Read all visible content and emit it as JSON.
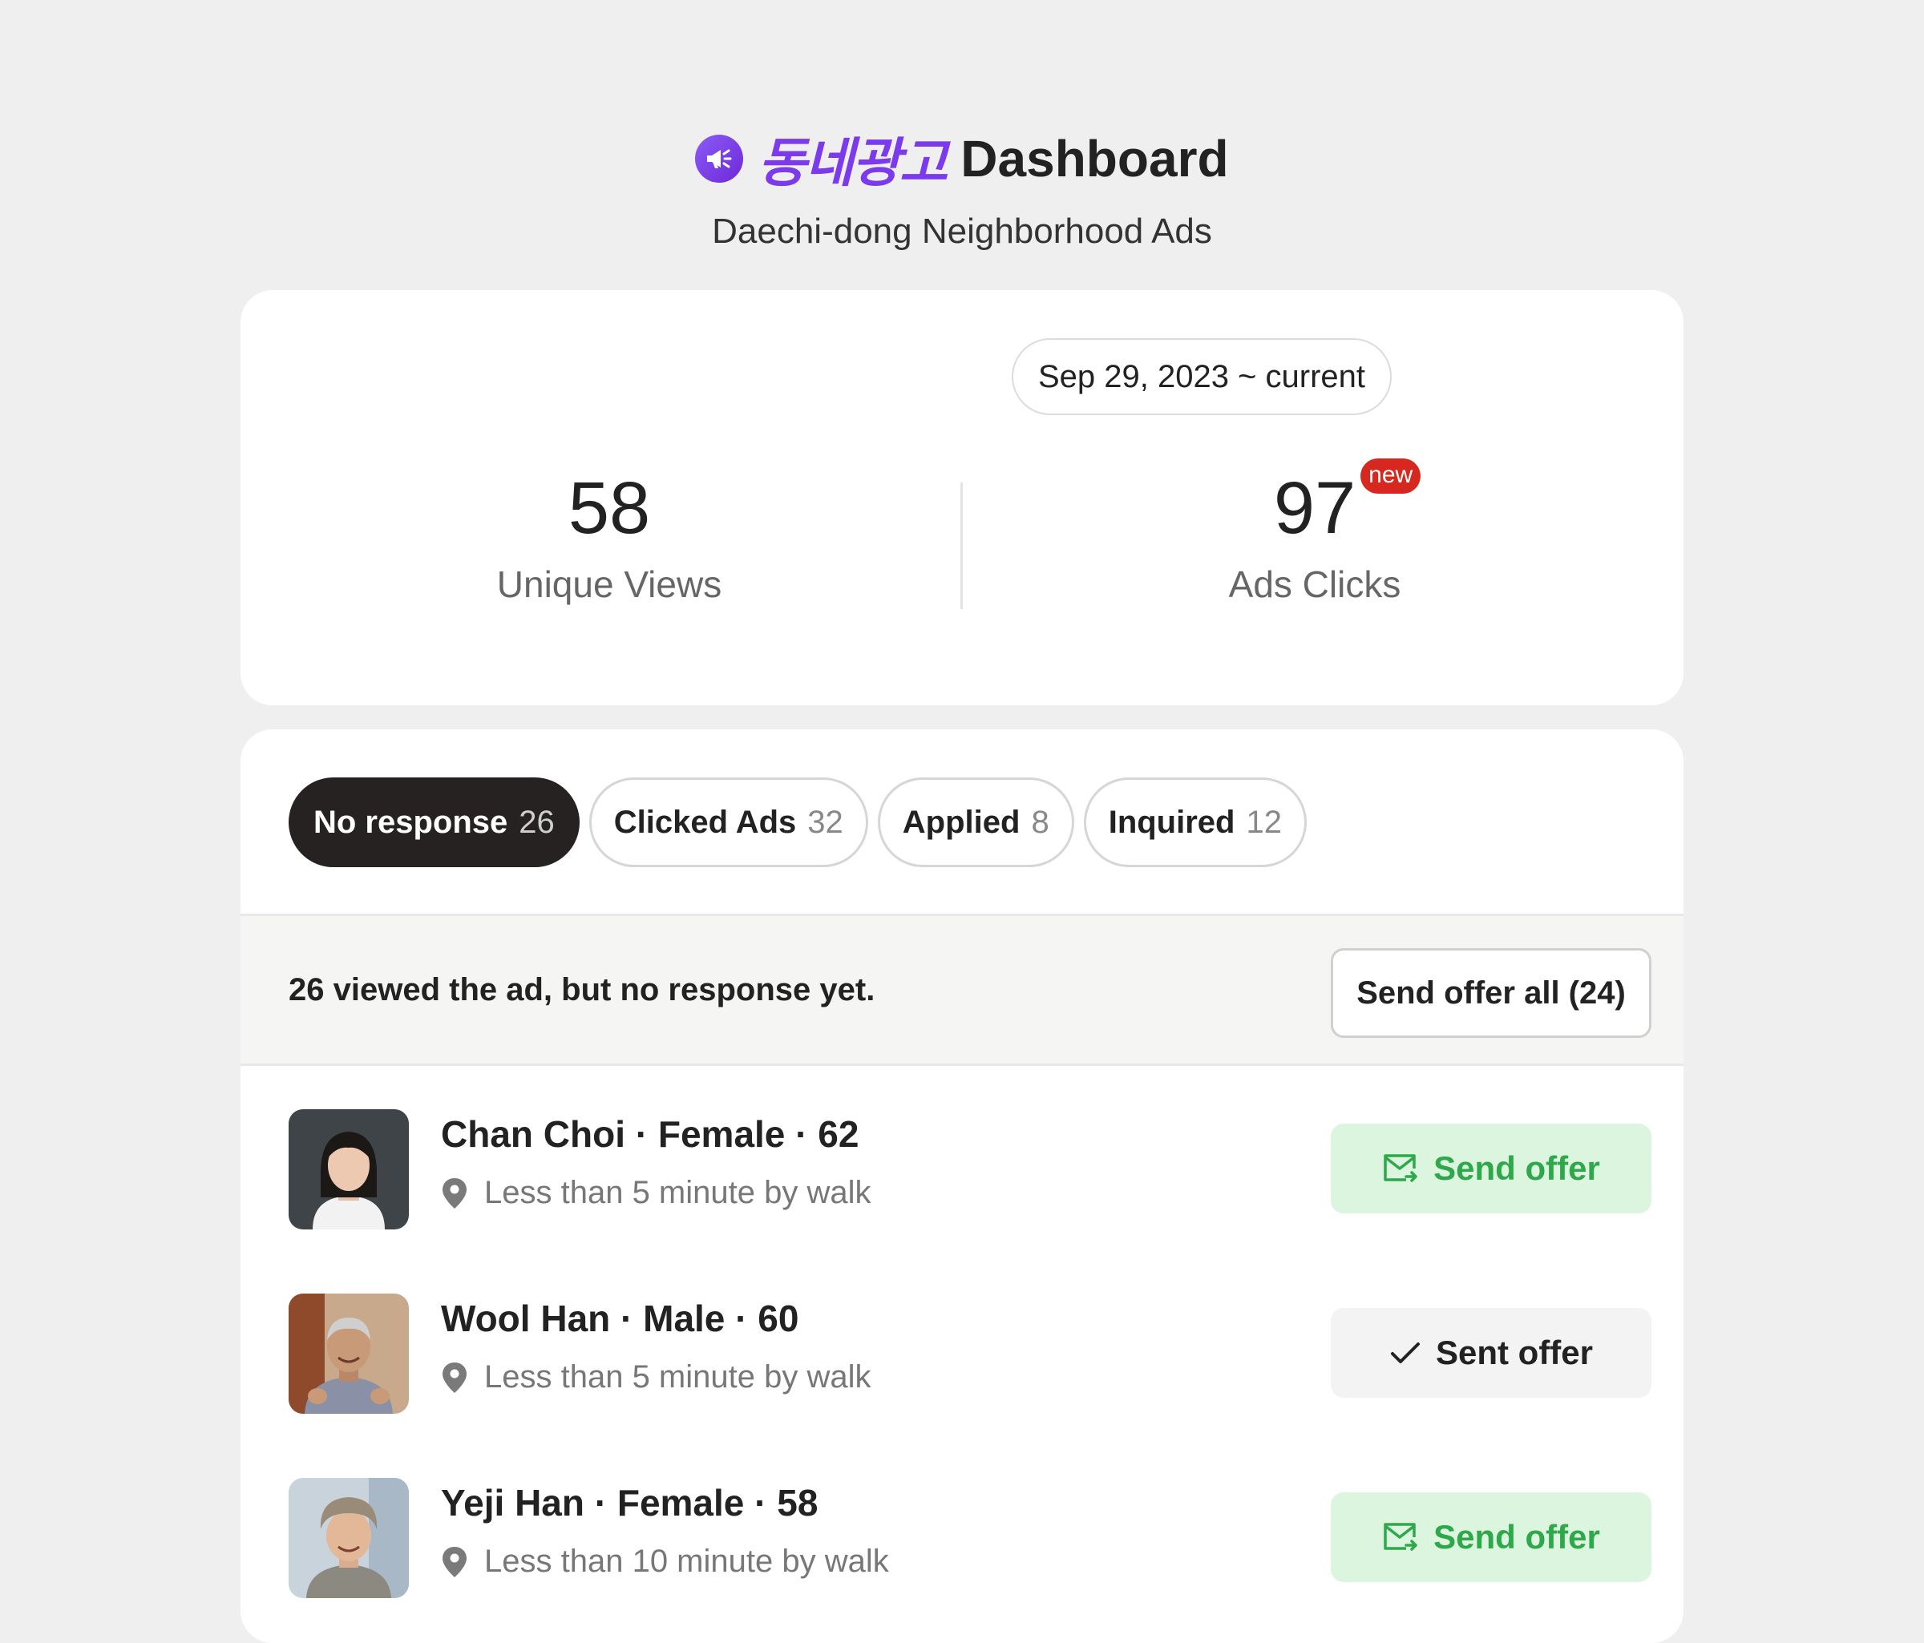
{
  "header": {
    "brand": "동네광고",
    "title": "Dashboard",
    "subtitle": "Daechi-dong Neighborhood Ads",
    "logo_icon": "megaphone-icon",
    "brand_color": "#7c3aed"
  },
  "stats": {
    "date_range": "Sep 29, 2023 ~ current",
    "unique_views": {
      "value": "58",
      "label": "Unique Views"
    },
    "ads_clicks": {
      "value": "97",
      "label": "Ads Clicks",
      "badge": "new"
    }
  },
  "tabs": [
    {
      "label": "No response",
      "count": "26",
      "active": true
    },
    {
      "label": "Clicked Ads",
      "count": "32",
      "active": false
    },
    {
      "label": "Applied",
      "count": "8",
      "active": false
    },
    {
      "label": "Inquired",
      "count": "12",
      "active": false
    }
  ],
  "info_bar": {
    "message": "26 viewed the ad, but no response yet.",
    "send_all_label": "Send offer all (24)"
  },
  "people": [
    {
      "name": "Chan Choi · Female · 62",
      "distance": "Less than 5 minute by walk",
      "action": "Send offer",
      "state": "send"
    },
    {
      "name": "Wool Han · Male · 60",
      "distance": "Less than 5 minute by walk",
      "action": "Sent offer",
      "state": "sent"
    },
    {
      "name": "Yeji Han · Female · 58",
      "distance": "Less than 10 minute by walk",
      "action": "Send offer",
      "state": "send"
    }
  ],
  "colors": {
    "accent_purple": "#7c3aed",
    "active_tab": "#262222",
    "send_green": "#2ea84a",
    "send_bg": "#dcf5de",
    "new_badge": "#d6281e"
  }
}
